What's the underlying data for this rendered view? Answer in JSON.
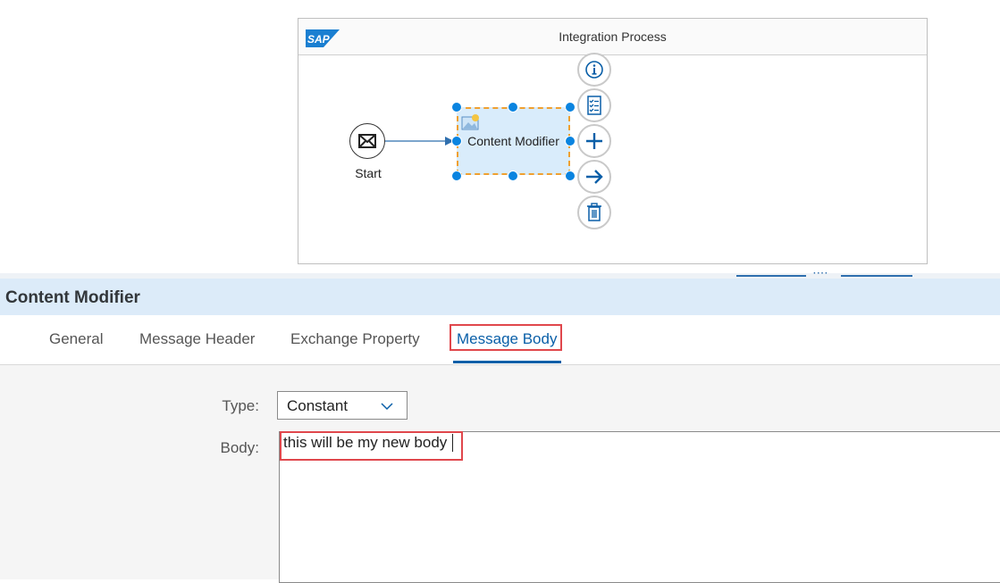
{
  "canvas": {
    "title": "Integration Process",
    "logo_text": "SAP",
    "start_event": {
      "label": "Start",
      "icon": "envelope-icon"
    },
    "step": {
      "label": "Content Modifier",
      "icon": "content-modifier-icon"
    },
    "context_actions": [
      {
        "name": "info-icon"
      },
      {
        "name": "checklist-icon"
      },
      {
        "name": "plus-icon"
      },
      {
        "name": "arrow-right-icon"
      },
      {
        "name": "trash-icon"
      }
    ]
  },
  "panel": {
    "title": "Content Modifier",
    "tabs": [
      "General",
      "Message Header",
      "Exchange Property",
      "Message Body"
    ],
    "active_tab": "Message Body",
    "type_label": "Type:",
    "type_value": "Constant",
    "body_label": "Body:",
    "body_value": "this will be my new body"
  },
  "colors": {
    "accent": "#0a5fa8",
    "highlight": "#e0474c",
    "handle": "#0a84e0",
    "step_fill": "#d9ecfb",
    "panel_header": "#dcebf9"
  }
}
